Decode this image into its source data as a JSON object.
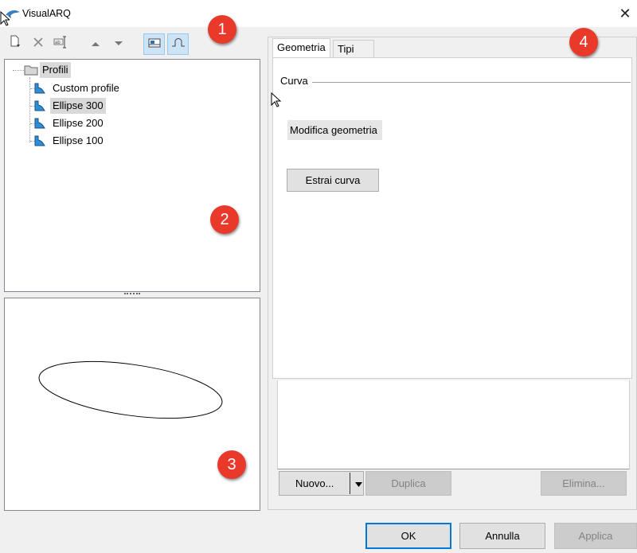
{
  "window": {
    "title": "VisualARQ"
  },
  "toolbar": {
    "icons": [
      "new-icon",
      "delete-icon",
      "rename-icon",
      "move-up-icon",
      "move-down-icon",
      "view-toggle-icon",
      "profile-toggle-icon"
    ]
  },
  "tree": {
    "root": "Profili",
    "items": [
      "Custom profile",
      "Ellipse 300",
      "Ellipse 200",
      "Ellipse 100"
    ],
    "selected": "Ellipse 300"
  },
  "tabs": [
    "Geometria",
    "Tipi"
  ],
  "geometry": {
    "section_label": "Curva",
    "modify_button": "Modifica geometria",
    "extract_button": "Estrai curva"
  },
  "list_actions": {
    "new": "Nuovo...",
    "duplicate": "Duplica",
    "delete": "Elimina..."
  },
  "dialog_buttons": {
    "ok": "OK",
    "cancel": "Annulla",
    "apply": "Applica"
  },
  "badges": [
    "1",
    "2",
    "3",
    "4"
  ],
  "colors": {
    "badge": "#e8392b",
    "accent": "#0078d7",
    "selection": "#cde4f7"
  }
}
